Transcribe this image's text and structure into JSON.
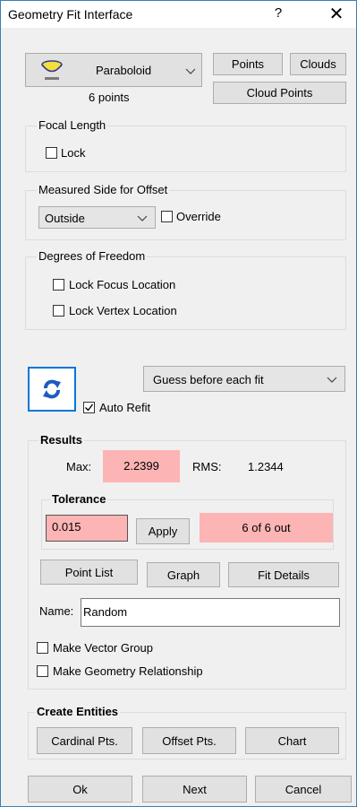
{
  "window": {
    "title": "Geometry Fit Interface",
    "help_label": "?",
    "close_label": "✕"
  },
  "geometry": {
    "type_label": "Paraboloid",
    "points_count": "6 points",
    "icon": "paraboloid-icon",
    "buttons": {
      "points": "Points",
      "clouds": "Clouds",
      "cloud_points": "Cloud Points"
    }
  },
  "focal_length": {
    "title": "Focal Length",
    "lock_label": "Lock",
    "lock_checked": false
  },
  "measured_side": {
    "title": "Measured Side for Offset",
    "selected": "Outside",
    "override_label": "Override",
    "override_checked": false
  },
  "dof": {
    "title": "Degrees of Freedom",
    "lock_focus_label": "Lock Focus Location",
    "lock_vertex_label": "Lock Vertex Location",
    "lock_focus_checked": false,
    "lock_vertex_checked": false
  },
  "refit": {
    "icon": "refresh-icon",
    "guess_option": "Guess before each fit",
    "auto_refit_label": "Auto Refit",
    "auto_refit_checked": true
  },
  "results": {
    "title": "Results",
    "max_label": "Max:",
    "max_value": "2.2399",
    "rms_label": "RMS:",
    "rms_value": "1.2344"
  },
  "tolerance": {
    "title": "Tolerance",
    "value": "0.015",
    "apply_label": "Apply",
    "out_status": "6 of 6 out"
  },
  "actions": {
    "point_list": "Point List",
    "graph": "Graph",
    "fit_details": "Fit Details"
  },
  "name": {
    "label": "Name:",
    "value": "Random"
  },
  "options": {
    "make_vector_group": "Make Vector Group",
    "make_geometry_relationship": "Make Geometry Relationship"
  },
  "create_entities": {
    "title": "Create Entities",
    "cardinal": "Cardinal Pts.",
    "offset": "Offset Pts.",
    "chart": "Chart"
  },
  "footer": {
    "ok": "Ok",
    "next": "Next",
    "cancel": "Cancel"
  },
  "colors": {
    "out_of_tolerance": "#fdb4b4",
    "accent": "#0078d7",
    "window_border": "#3c7fb1"
  }
}
